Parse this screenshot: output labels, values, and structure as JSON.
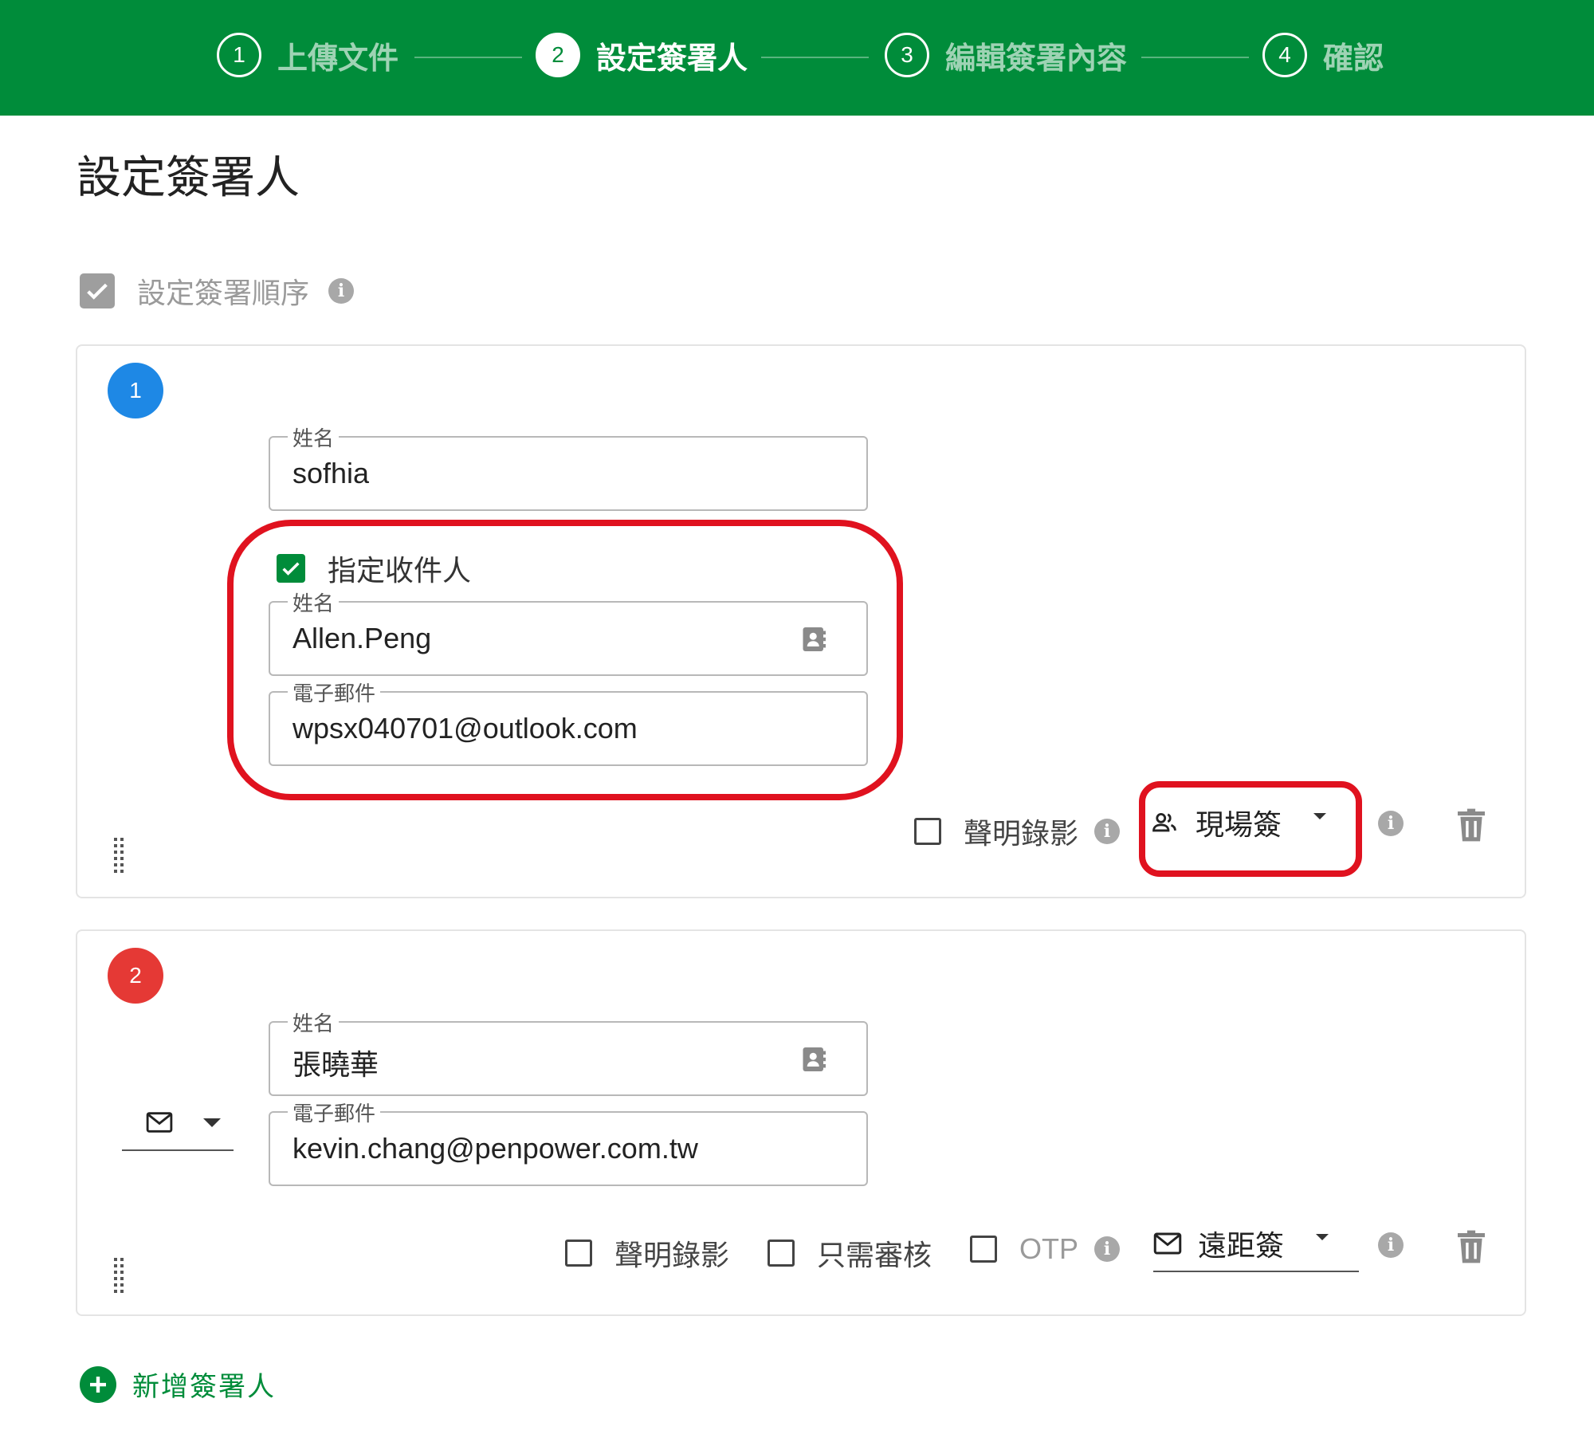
{
  "stepper": {
    "steps": [
      {
        "number": "1",
        "label": "上傳文件",
        "state": "done"
      },
      {
        "number": "2",
        "label": "設定簽署人",
        "state": "active"
      },
      {
        "number": "3",
        "label": "編輯簽署內容",
        "state": "pending"
      },
      {
        "number": "4",
        "label": "確認",
        "state": "pending"
      }
    ]
  },
  "page": {
    "title": "設定簽署人",
    "order_checkbox_label": "設定簽署順序",
    "order_checkbox_checked": true
  },
  "signers": [
    {
      "index": "1",
      "badge_color": "#1e88e5",
      "name_label": "姓名",
      "name_value": "sofhia",
      "assign_recipient_label": "指定收件人",
      "assign_recipient_checked": true,
      "recipient_name_label": "姓名",
      "recipient_name_value": "Allen.Peng",
      "recipient_email_label": "電子郵件",
      "recipient_email_value": "wpsx040701@outlook.com",
      "video_statement_label": "聲明錄影",
      "sign_mode": "現場簽",
      "sign_mode_icon": "people-icon"
    },
    {
      "index": "2",
      "badge_color": "#e53935",
      "name_label": "姓名",
      "name_value": "張曉華",
      "email_label": "電子郵件",
      "email_value": "kevin.chang@penpower.com.tw",
      "contact_method_icon": "mail-icon",
      "video_statement_label": "聲明錄影",
      "review_only_label": "只需審核",
      "otp_label": "OTP",
      "sign_mode": "遠距簽",
      "sign_mode_icon": "mail-icon"
    }
  ],
  "add_signer_label": "新增簽署人",
  "colors": {
    "header_green": "#008c3a",
    "highlight_red": "#e0121f"
  }
}
